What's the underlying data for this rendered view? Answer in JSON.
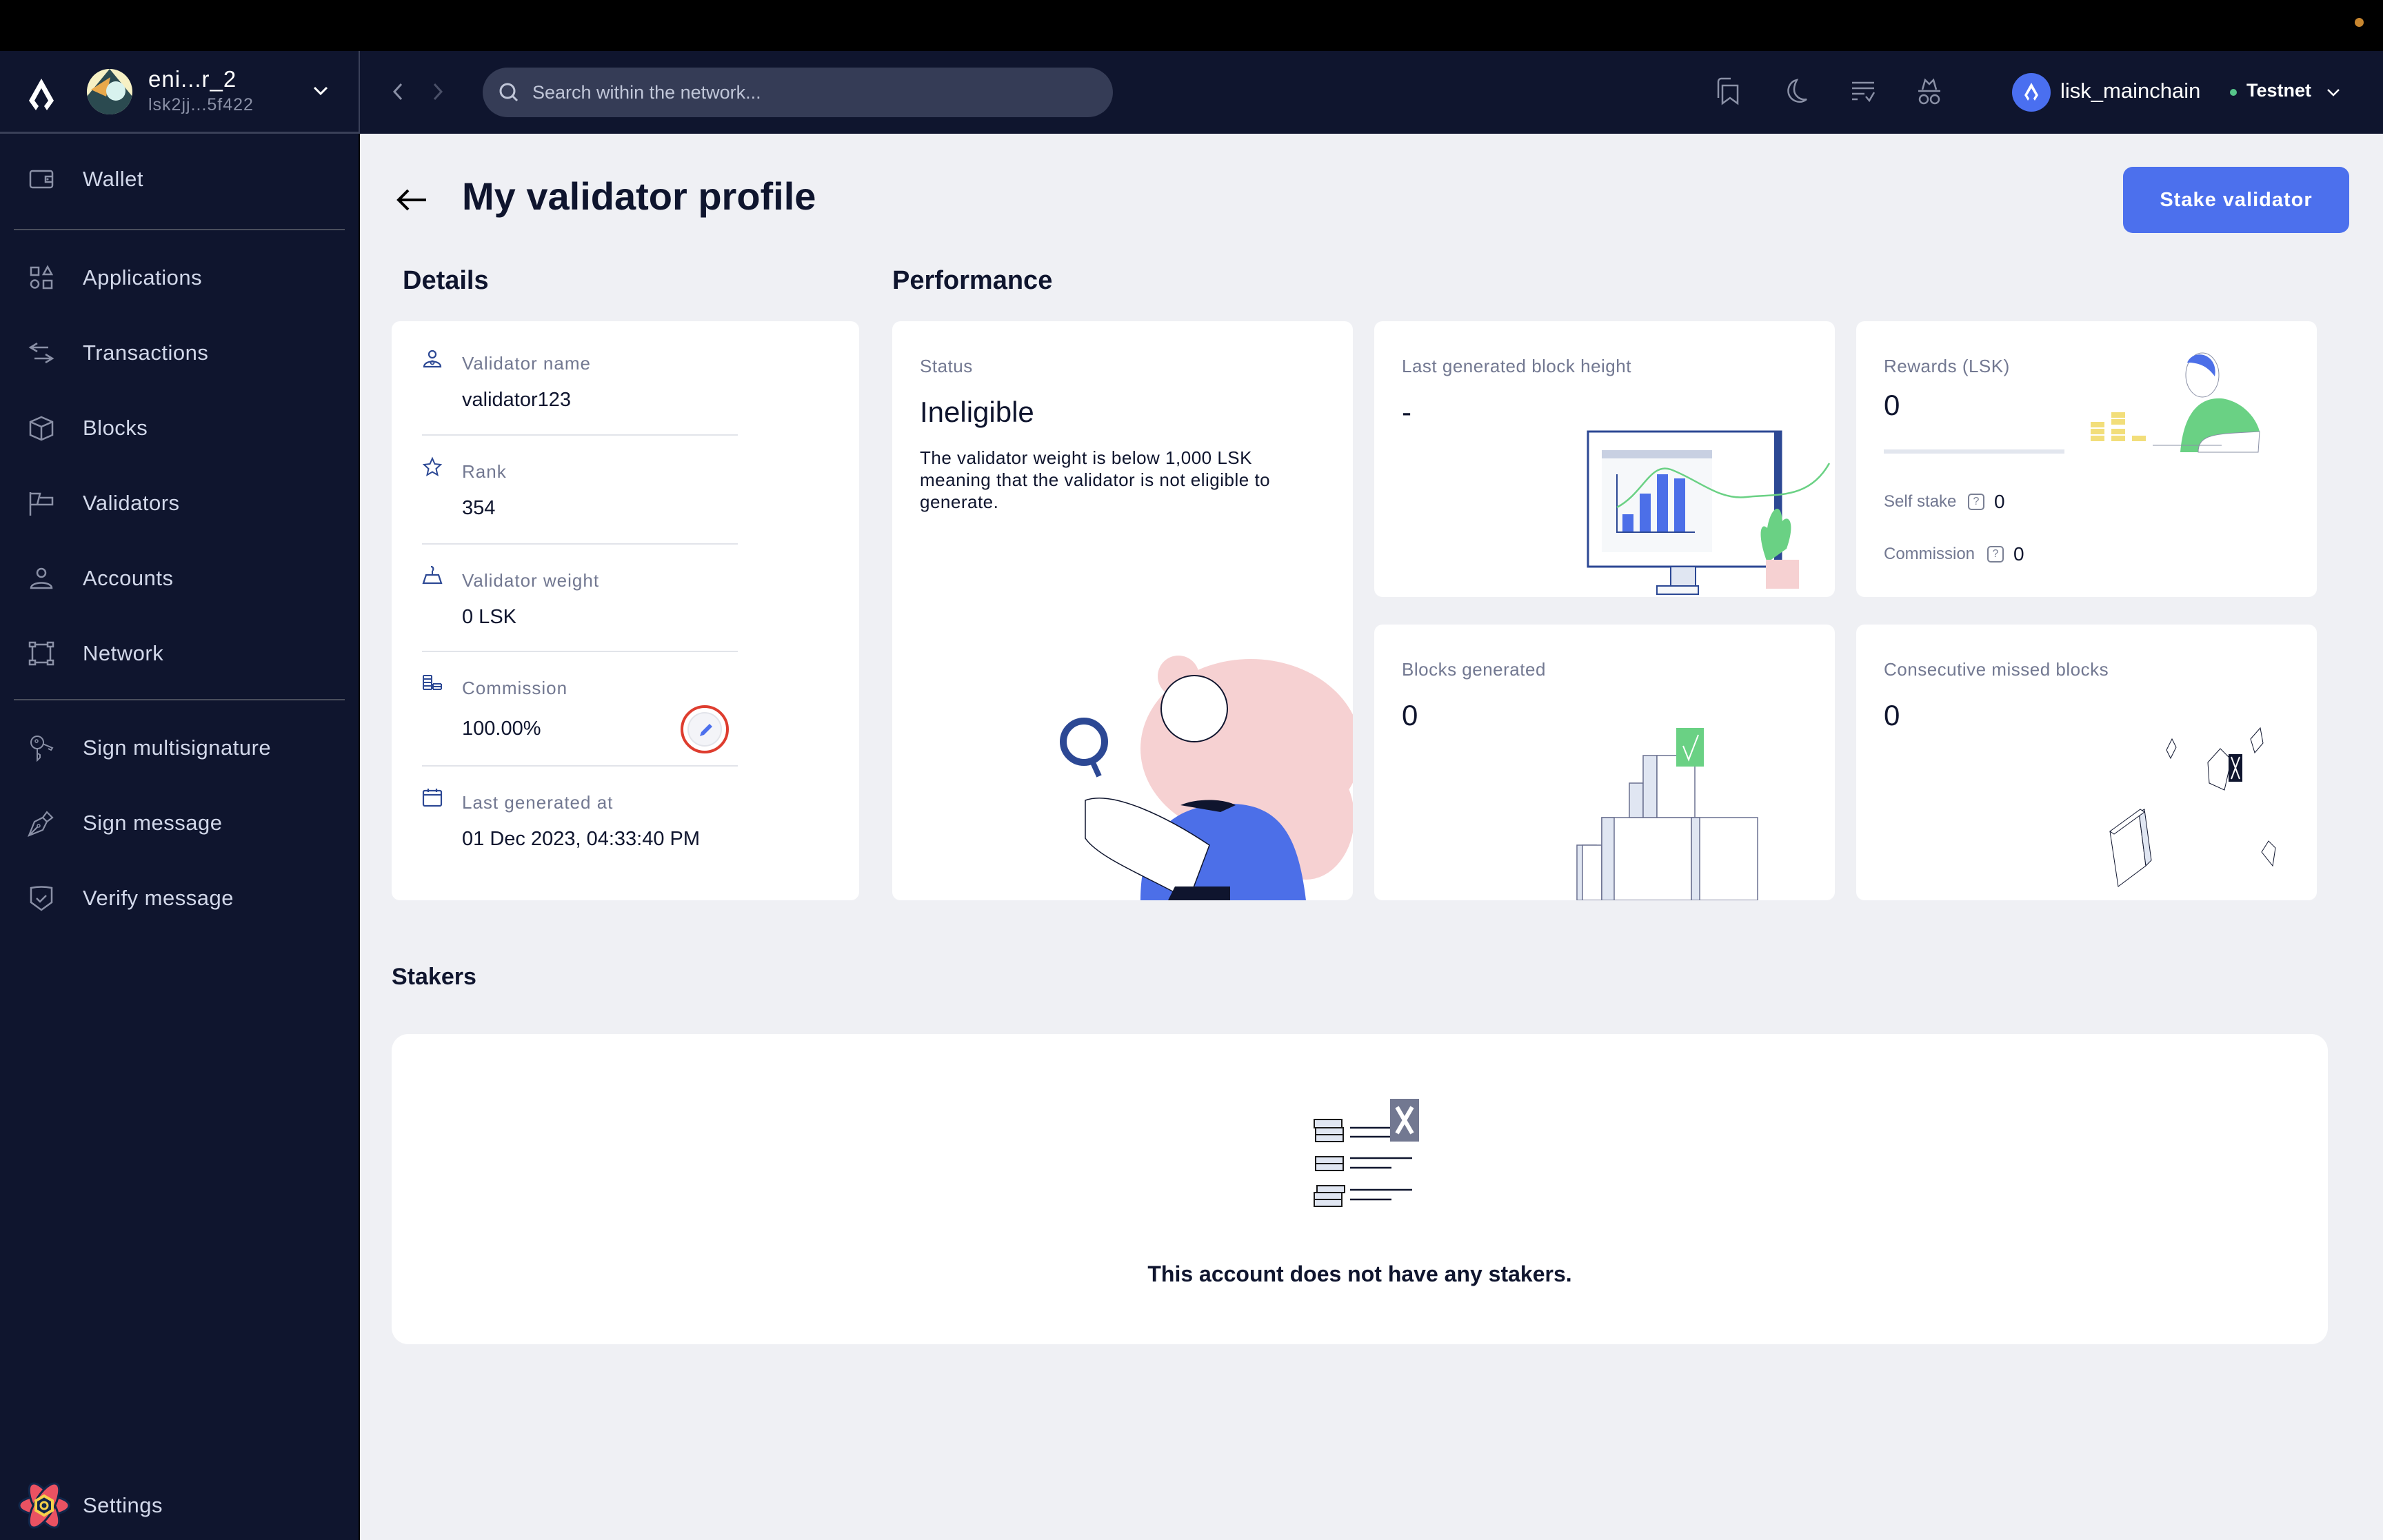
{
  "account": {
    "name": "eni...r_2",
    "address": "lsk2jj...5f422"
  },
  "sidebar": {
    "items": [
      {
        "label": "Wallet",
        "icon": "wallet-icon"
      },
      {
        "label": "Applications",
        "icon": "applications-icon"
      },
      {
        "label": "Transactions",
        "icon": "transactions-icon"
      },
      {
        "label": "Blocks",
        "icon": "blocks-icon"
      },
      {
        "label": "Validators",
        "icon": "flag-icon"
      },
      {
        "label": "Accounts",
        "icon": "user-icon"
      },
      {
        "label": "Network",
        "icon": "network-icon"
      },
      {
        "label": "Sign multisignature",
        "icon": "keys-icon"
      },
      {
        "label": "Sign message",
        "icon": "pen-icon"
      },
      {
        "label": "Verify message",
        "icon": "shield-check-icon"
      }
    ],
    "settings_label": "Settings"
  },
  "navbar": {
    "search_placeholder": "Search within the network...",
    "icons": [
      "bookmarks-icon",
      "moon-icon",
      "pending-transactions-icon",
      "incognito-icon"
    ],
    "chain_name": "lisk_mainchain",
    "network_name": "Testnet",
    "network_status_color": "#56c58a"
  },
  "page": {
    "title": "My validator profile",
    "stake_button": "Stake validator",
    "accent_color": "#4c70ed"
  },
  "details": {
    "title": "Details",
    "rows": [
      {
        "label": "Validator name",
        "value": "validator123"
      },
      {
        "label": "Rank",
        "value": "354"
      },
      {
        "label": "Validator weight",
        "value": "0 LSK"
      },
      {
        "label": "Commission",
        "value": "100.00%"
      },
      {
        "label": "Last generated at",
        "value": "01 Dec 2023, 04:33:40 PM"
      }
    ]
  },
  "performance": {
    "title": "Performance",
    "status": {
      "label": "Status",
      "value": "Ineligible",
      "description": "The validator weight is below 1,000 LSK meaning that the validator is not eligible to generate."
    },
    "last_block_height": {
      "label": "Last generated block height",
      "value": "-"
    },
    "rewards": {
      "label": "Rewards (LSK)",
      "value": "0",
      "self_stake_label": "Self stake",
      "self_stake_value": "0",
      "commission_label": "Commission",
      "commission_value": "0"
    },
    "blocks_generated": {
      "label": "Blocks generated",
      "value": "0"
    },
    "missed_blocks": {
      "label": "Consecutive missed blocks",
      "value": "0"
    }
  },
  "stakers": {
    "title": "Stakers",
    "empty_message": "This account does not have any stakers."
  }
}
